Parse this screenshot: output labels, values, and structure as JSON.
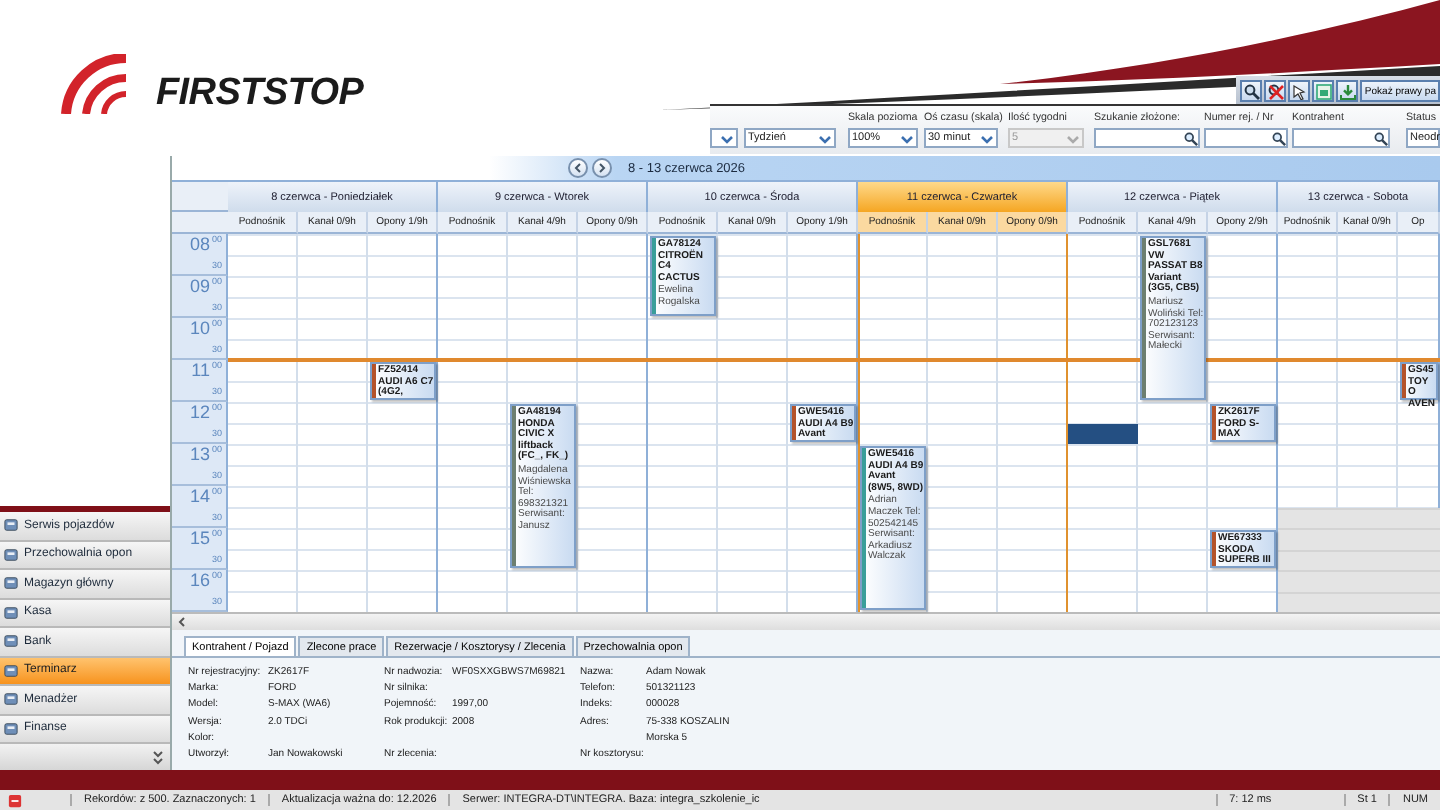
{
  "header": {
    "logo": "FIRSTSTOP",
    "toolbar_buttons": [
      {
        "kind": "search"
      },
      {
        "kind": "clear"
      },
      {
        "kind": "pointer"
      },
      {
        "kind": "window"
      },
      {
        "kind": "download"
      }
    ],
    "panel_button": "Pokaż prawy pa"
  },
  "filters": [
    {
      "kind": "select",
      "disabled": false
    },
    {
      "kind": "select",
      "value": "Tydzień",
      "disabled": false
    },
    {
      "kind": "select",
      "label": "Skala pozioma",
      "value": "100%",
      "disabled": false
    },
    {
      "kind": "select",
      "label": "Oś czasu (skala)",
      "value": "30 minut",
      "disabled": false
    },
    {
      "kind": "select",
      "label": "Ilość tygodni",
      "value": "5",
      "disabled": true
    },
    {
      "kind": "search",
      "label": "Szukanie złożone:",
      "disabled": false
    },
    {
      "kind": "search",
      "label": "Numer rej. / Nr",
      "disabled": false
    },
    {
      "kind": "search",
      "label": "Kontrahent",
      "disabled": false
    },
    {
      "kind": "field",
      "label": "Status",
      "value": "Neodr",
      "disabled": false
    }
  ],
  "sidebar": {
    "items": [
      {
        "label": "Serwis pojazdów",
        "selected": false
      },
      {
        "label": "Przechowalnia opon",
        "selected": false
      },
      {
        "label": "Magazyn główny",
        "selected": false
      },
      {
        "label": "Kasa",
        "selected": false
      },
      {
        "label": "Bank",
        "selected": false
      },
      {
        "label": "Terminarz",
        "selected": true
      },
      {
        "label": "Menadżer",
        "selected": false
      },
      {
        "label": "Finanse",
        "selected": false
      }
    ]
  },
  "calendar": {
    "range_title": "8 - 13 czerwca 2026",
    "hours": [
      {
        "hour": "08",
        "first": "00",
        "second": "30",
        "now": false
      },
      {
        "hour": "09",
        "first": "00",
        "second": "30",
        "now": false
      },
      {
        "hour": "10",
        "first": "00",
        "second": "30",
        "now": false
      },
      {
        "hour": "11",
        "first": "00",
        "second": "30",
        "now": true
      },
      {
        "hour": "12",
        "first": "00",
        "second": "30",
        "now": false
      },
      {
        "hour": "13",
        "first": "00",
        "second": "30",
        "now": false
      },
      {
        "hour": "14",
        "first": "00",
        "second": "30",
        "now": false
      },
      {
        "hour": "15",
        "first": "00",
        "second": "30",
        "now": false
      },
      {
        "hour": "16",
        "first": "00",
        "second": "30",
        "now": false
      }
    ],
    "days": [
      {
        "title": "8 czerwca - Poniedziałek",
        "today": false,
        "columns": [
          {
            "name": "Podnośnik"
          },
          {
            "name": "Kanał 0/9h"
          },
          {
            "name": "Opony 1/9h",
            "slots": [
              {
                "kind": "free"
              },
              {
                "kind": "free"
              },
              {
                "kind": "free"
              },
              {
                "kind": "free"
              },
              {
                "kind": "free"
              },
              {
                "kind": "free"
              },
              {
                "kind": "booking",
                "color": "#b4532a",
                "vehicle": "FZ52414 AUDI A6 C7 (4G2,"
              },
              {
                "kind": "continued"
              }
            ]
          }
        ]
      },
      {
        "title": "9 czerwca - Wtorek",
        "today": false,
        "columns": [
          {
            "name": "Podnośnik"
          },
          {
            "name": "Kanał 4/9h",
            "slots": [
              {
                "kind": "free"
              },
              {
                "kind": "free"
              },
              {
                "kind": "free"
              },
              {
                "kind": "free"
              },
              {
                "kind": "free"
              },
              {
                "kind": "free"
              },
              {
                "kind": "free"
              },
              {
                "kind": "free"
              },
              {
                "kind": "booking",
                "color": "#6d7f70",
                "vehicle": "GA48194 HONDA CIVIC X liftback (FC_, FK_)",
                "details": "Magdalena Wiśniewska Tel: 698321321 Serwisant: Janusz"
              },
              {
                "kind": "continued"
              },
              {
                "kind": "continued"
              },
              {
                "kind": "continued"
              },
              {
                "kind": "continued"
              },
              {
                "kind": "continued"
              },
              {
                "kind": "continued"
              },
              {
                "kind": "continued"
              }
            ]
          },
          {
            "name": "Opony 0/9h"
          }
        ]
      },
      {
        "title": "10 czerwca - Środa",
        "today": false,
        "columns": [
          {
            "name": "Podnośnik",
            "slots": [
              {
                "kind": "booking",
                "color": "#3a9e9a",
                "vehicle": "GA78124 CITROËN C4 CACTUS",
                "details": "Ewelina Rogalska"
              },
              {
                "kind": "continued"
              },
              {
                "kind": "continued"
              },
              {
                "kind": "continued"
              }
            ]
          },
          {
            "name": "Kanał 0/9h"
          },
          {
            "name": "Opony 1/9h",
            "slots": [
              {
                "kind": "free"
              },
              {
                "kind": "free"
              },
              {
                "kind": "free"
              },
              {
                "kind": "free"
              },
              {
                "kind": "free"
              },
              {
                "kind": "free"
              },
              {
                "kind": "free"
              },
              {
                "kind": "free"
              },
              {
                "kind": "booking",
                "color": "#b4532a",
                "vehicle": "GWE5416 AUDI A4 B9 Avant"
              },
              {
                "kind": "continued"
              }
            ]
          }
        ]
      },
      {
        "title": "11 czerwca - Czwartek",
        "today": true,
        "columns": [
          {
            "name": "Podnośnik",
            "slots": [
              {
                "kind": "free"
              },
              {
                "kind": "free"
              },
              {
                "kind": "free"
              },
              {
                "kind": "free"
              },
              {
                "kind": "free"
              },
              {
                "kind": "free"
              },
              {
                "kind": "free"
              },
              {
                "kind": "free"
              },
              {
                "kind": "free"
              },
              {
                "kind": "free"
              },
              {
                "kind": "booking",
                "color": "#3a9e9a",
                "vehicle": "GWE5416 AUDI A4 B9 Avant (8W5, 8WD)",
                "details": "Adrian Maczek Tel: 502542145 Serwisant: Arkadiusz Walczak"
              },
              {
                "kind": "continued"
              },
              {
                "kind": "continued"
              },
              {
                "kind": "continued"
              },
              {
                "kind": "continued"
              },
              {
                "kind": "continued"
              },
              {
                "kind": "continued"
              },
              {
                "kind": "continued"
              }
            ]
          },
          {
            "name": "Kanał 0/9h"
          },
          {
            "name": "Opony 0/9h"
          }
        ]
      },
      {
        "title": "12 czerwca - Piątek",
        "today": false,
        "columns": [
          {
            "name": "Podnośnik",
            "slots": [
              {
                "kind": "free"
              },
              {
                "kind": "free"
              },
              {
                "kind": "free"
              },
              {
                "kind": "free"
              },
              {
                "kind": "free"
              },
              {
                "kind": "free"
              },
              {
                "kind": "free"
              },
              {
                "kind": "free"
              },
              {
                "kind": "free"
              },
              {
                "kind": "selection"
              }
            ]
          },
          {
            "name": "Kanał 4/9h",
            "slots": [
              {
                "kind": "booking",
                "color": "#6d7f70",
                "vehicle": "GSL7681 VW PASSAT B8 Variant (3G5, CB5)",
                "details": "Mariusz Woliński Tel: 702123123 Serwisant: Małecki"
              },
              {
                "kind": "continued"
              },
              {
                "kind": "continued"
              },
              {
                "kind": "continued"
              },
              {
                "kind": "continued"
              },
              {
                "kind": "continued"
              },
              {
                "kind": "continued"
              },
              {
                "kind": "continued"
              }
            ]
          },
          {
            "name": "Opony 2/9h",
            "slots": [
              {
                "kind": "free"
              },
              {
                "kind": "free"
              },
              {
                "kind": "free"
              },
              {
                "kind": "free"
              },
              {
                "kind": "free"
              },
              {
                "kind": "free"
              },
              {
                "kind": "free"
              },
              {
                "kind": "free"
              },
              {
                "kind": "booking",
                "color": "#b4532a",
                "vehicle": "ZK2617F FORD S-MAX"
              },
              {
                "kind": "continued"
              },
              {
                "kind": "free"
              },
              {
                "kind": "free"
              },
              {
                "kind": "free"
              },
              {
                "kind": "free"
              },
              {
                "kind": "booking",
                "color": "#b4532a",
                "vehicle": "WE67333 SKODA SUPERB III"
              },
              {
                "kind": "continued"
              }
            ]
          }
        ]
      },
      {
        "title": "13 czerwca - Sobota",
        "today": false,
        "columns": [
          {
            "name": "Podnośnik",
            "slots": [
              {
                "kind": "free"
              },
              {
                "kind": "free"
              },
              {
                "kind": "free"
              },
              {
                "kind": "free"
              },
              {
                "kind": "free"
              },
              {
                "kind": "free"
              },
              {
                "kind": "free"
              },
              {
                "kind": "free"
              },
              {
                "kind": "free"
              },
              {
                "kind": "free"
              },
              {
                "kind": "free"
              },
              {
                "kind": "free"
              },
              {
                "kind": "free"
              },
              {
                "kind": "closed"
              },
              {
                "kind": "closed"
              },
              {
                "kind": "closed"
              },
              {
                "kind": "closed"
              },
              {
                "kind": "closed"
              }
            ]
          },
          {
            "name": "Kanał 0/9h",
            "slots": [
              {
                "kind": "free"
              },
              {
                "kind": "free"
              },
              {
                "kind": "free"
              },
              {
                "kind": "free"
              },
              {
                "kind": "free"
              },
              {
                "kind": "free"
              },
              {
                "kind": "free"
              },
              {
                "kind": "free"
              },
              {
                "kind": "free"
              },
              {
                "kind": "free"
              },
              {
                "kind": "free"
              },
              {
                "kind": "free"
              },
              {
                "kind": "free"
              },
              {
                "kind": "closed"
              },
              {
                "kind": "closed"
              },
              {
                "kind": "closed"
              },
              {
                "kind": "closed"
              },
              {
                "kind": "closed"
              }
            ]
          },
          {
            "name": "Op",
            "slots": [
              {
                "kind": "free"
              },
              {
                "kind": "free"
              },
              {
                "kind": "free"
              },
              {
                "kind": "free"
              },
              {
                "kind": "free"
              },
              {
                "kind": "free"
              },
              {
                "kind": "booking",
                "color": "#b4532a",
                "vehicle": "GS45 TOYO AVEN"
              },
              {
                "kind": "continued"
              },
              {
                "kind": "free"
              },
              {
                "kind": "free"
              },
              {
                "kind": "free"
              },
              {
                "kind": "free"
              },
              {
                "kind": "free"
              },
              {
                "kind": "closed"
              },
              {
                "kind": "closed"
              },
              {
                "kind": "closed"
              },
              {
                "kind": "closed"
              },
              {
                "kind": "closed"
              }
            ]
          }
        ]
      }
    ]
  },
  "details": {
    "tabs": [
      {
        "label": "Kontrahent / Pojazd",
        "selected": true
      },
      {
        "label": "Zlecone prace",
        "selected": false
      },
      {
        "label": "Rezerwacje / Kosztorysy / Zlecenia",
        "selected": false
      },
      {
        "label": "Przechowalnia opon",
        "selected": false
      }
    ],
    "rows": [
      [
        {
          "label": "Nr rejestracyjny:",
          "value": "ZK2617F"
        },
        {
          "label": "Nr nadwozia:",
          "value": "WF0SXXGBWS7M69821"
        },
        {
          "label": "Nazwa:",
          "value": "Adam Nowak"
        }
      ],
      [
        {
          "label": "Marka:",
          "value": "FORD"
        },
        {
          "label": "Nr silnika:"
        },
        {
          "label": "Telefon:",
          "value": "501321123"
        }
      ],
      [
        {
          "label": "Model:",
          "value": "S-MAX (WA6)"
        },
        {
          "label": "Pojemność:",
          "value": "1997,00"
        },
        {
          "label": "Indeks:",
          "value": "000028"
        }
      ],
      [
        {
          "label": "Wersja:",
          "value": "2.0 TDCi"
        },
        {
          "label": "Rok produkcji:",
          "value": "2008"
        },
        {
          "label": "Adres:",
          "value": "75-338 KOSZALIN"
        }
      ],
      [
        {
          "label": "Kolor:"
        },
        {},
        {
          "value": "Morska 5"
        }
      ],
      [
        {
          "label": "Utworzył:",
          "value": "Jan Nowakowski"
        },
        {
          "label": "Nr zlecenia:"
        },
        {
          "label": "Nr kosztorysu:"
        }
      ]
    ]
  },
  "status_bar": [
    "Rekordów: z 500. Zaznaczonych: 1",
    "Aktualizacja ważna do: 12.2026",
    "Serwer: INTEGRA-DT\\INTEGRA. Baza: integra_szkolenie_ic",
    "7: 12 ms",
    "St 1",
    "NUM"
  ]
}
